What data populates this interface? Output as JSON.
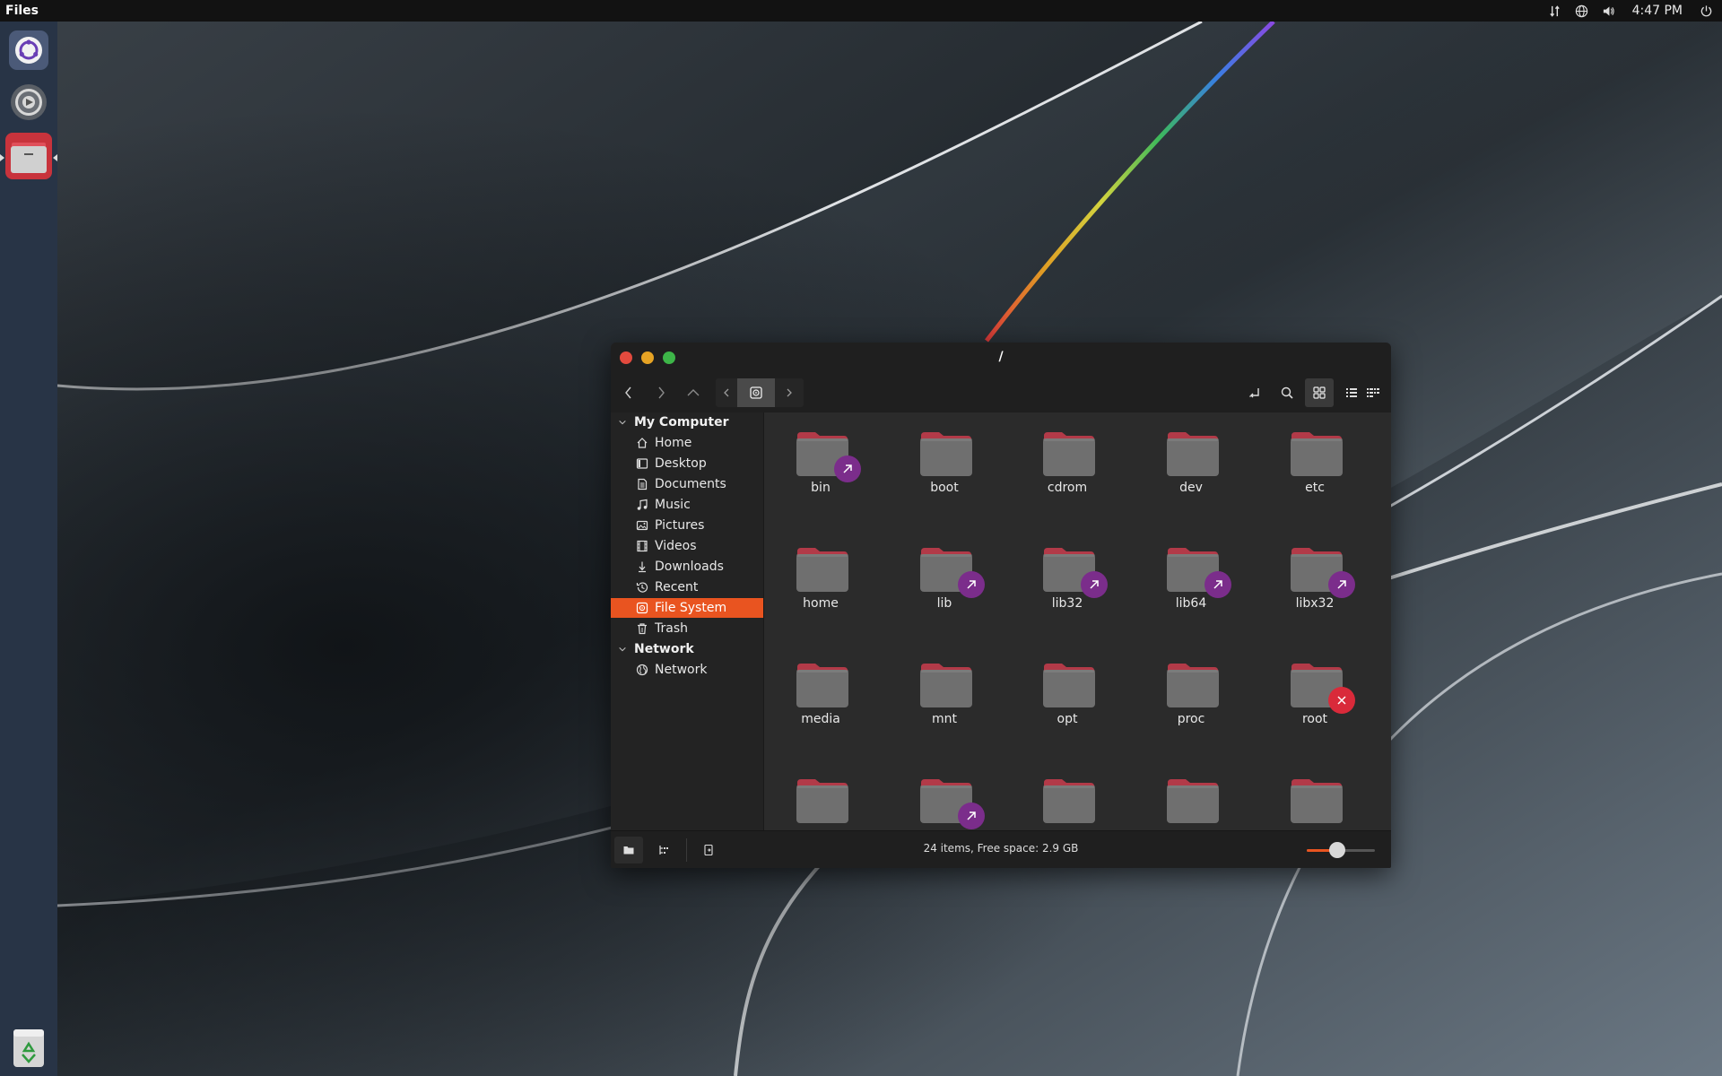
{
  "top_panel": {
    "app_name": "Files",
    "clock": "4:47 PM",
    "tray_icons": [
      "network-transfer-icon",
      "globe-icon",
      "volume-icon",
      "power-icon"
    ]
  },
  "launcher": {
    "items": [
      "ubuntu-logo-icon",
      "settings-gear-icon",
      "files-folder-icon"
    ],
    "trash_icon": "recycle-icon"
  },
  "window": {
    "title": "/",
    "toolbar": {
      "buttons": [
        "back",
        "forward",
        "up",
        "crumb-left",
        "filesystem-root",
        "crumb-right",
        "toggle-location",
        "search",
        "icon-view",
        "list-view",
        "compact-view"
      ]
    },
    "sidebar": {
      "sections": [
        {
          "label": "My Computer",
          "items": [
            {
              "label": "Home",
              "icon": "home-icon"
            },
            {
              "label": "Desktop",
              "icon": "desktop-icon"
            },
            {
              "label": "Documents",
              "icon": "document-icon"
            },
            {
              "label": "Music",
              "icon": "music-icon"
            },
            {
              "label": "Pictures",
              "icon": "picture-icon"
            },
            {
              "label": "Videos",
              "icon": "video-icon"
            },
            {
              "label": "Downloads",
              "icon": "download-icon"
            },
            {
              "label": "Recent",
              "icon": "history-icon"
            },
            {
              "label": "File System",
              "icon": "drive-icon",
              "active": true
            },
            {
              "label": "Trash",
              "icon": "trash-icon"
            }
          ]
        },
        {
          "label": "Network",
          "items": [
            {
              "label": "Network",
              "icon": "globe-icon"
            }
          ]
        }
      ]
    },
    "files": [
      {
        "name": "bin",
        "emblem": "symlink"
      },
      {
        "name": "boot",
        "emblem": ""
      },
      {
        "name": "cdrom",
        "emblem": ""
      },
      {
        "name": "dev",
        "emblem": ""
      },
      {
        "name": "etc",
        "emblem": ""
      },
      {
        "name": "home",
        "emblem": ""
      },
      {
        "name": "lib",
        "emblem": "symlink"
      },
      {
        "name": "lib32",
        "emblem": "symlink"
      },
      {
        "name": "lib64",
        "emblem": "symlink"
      },
      {
        "name": "libx32",
        "emblem": "symlink"
      },
      {
        "name": "media",
        "emblem": ""
      },
      {
        "name": "mnt",
        "emblem": ""
      },
      {
        "name": "opt",
        "emblem": ""
      },
      {
        "name": "proc",
        "emblem": ""
      },
      {
        "name": "root",
        "emblem": "unreadable"
      },
      {
        "name": "",
        "emblem": ""
      },
      {
        "name": "",
        "emblem": "symlink"
      },
      {
        "name": "",
        "emblem": ""
      },
      {
        "name": "",
        "emblem": ""
      },
      {
        "name": "",
        "emblem": ""
      }
    ],
    "status": "24 items, Free space: 2.9 GB",
    "zoom_level": 0.45,
    "colors": {
      "accent": "#e95420",
      "symlink_emblem": "#7b2d8b",
      "unreadable_emblem": "#d92a3a",
      "folder_body": "#6f6f6f",
      "folder_tab": "#b23a48"
    }
  }
}
